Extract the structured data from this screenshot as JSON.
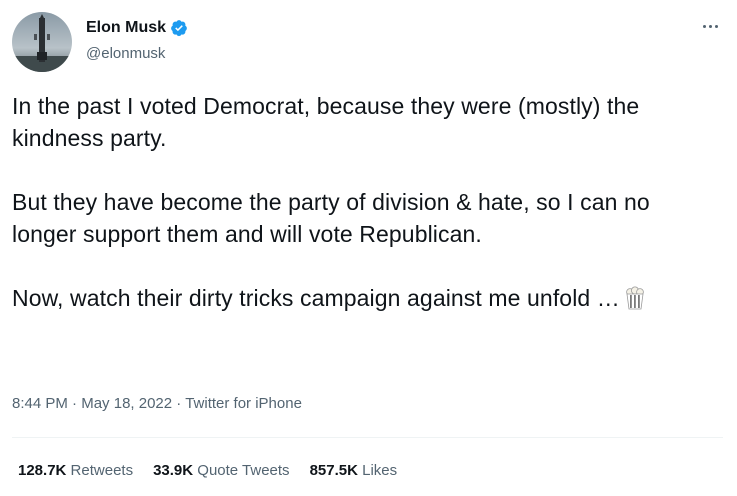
{
  "author": {
    "display_name": "Elon Musk",
    "handle": "@elonmusk",
    "verified_color": "#1d9bf0"
  },
  "tweet": {
    "paragraphs": [
      "In the past I voted Democrat, because they were (mostly) the kindness party.",
      "But they have become the party of division & hate, so I can no longer support them and will vote Republican.",
      "Now, watch their dirty tricks campaign against me unfold …"
    ],
    "emoji": "popcorn-icon"
  },
  "meta": {
    "time": "8:44 PM",
    "separator": " · ",
    "date": "May 18, 2022",
    "source": "Twitter for iPhone"
  },
  "stats": {
    "retweets_count": "128.7K",
    "retweets_label": "Retweets",
    "quotes_count": "33.9K",
    "quotes_label": "Quote Tweets",
    "likes_count": "857.5K",
    "likes_label": "Likes"
  },
  "colors": {
    "text": "#0f1419",
    "secondary": "#536471",
    "divider": "#eff3f4"
  }
}
